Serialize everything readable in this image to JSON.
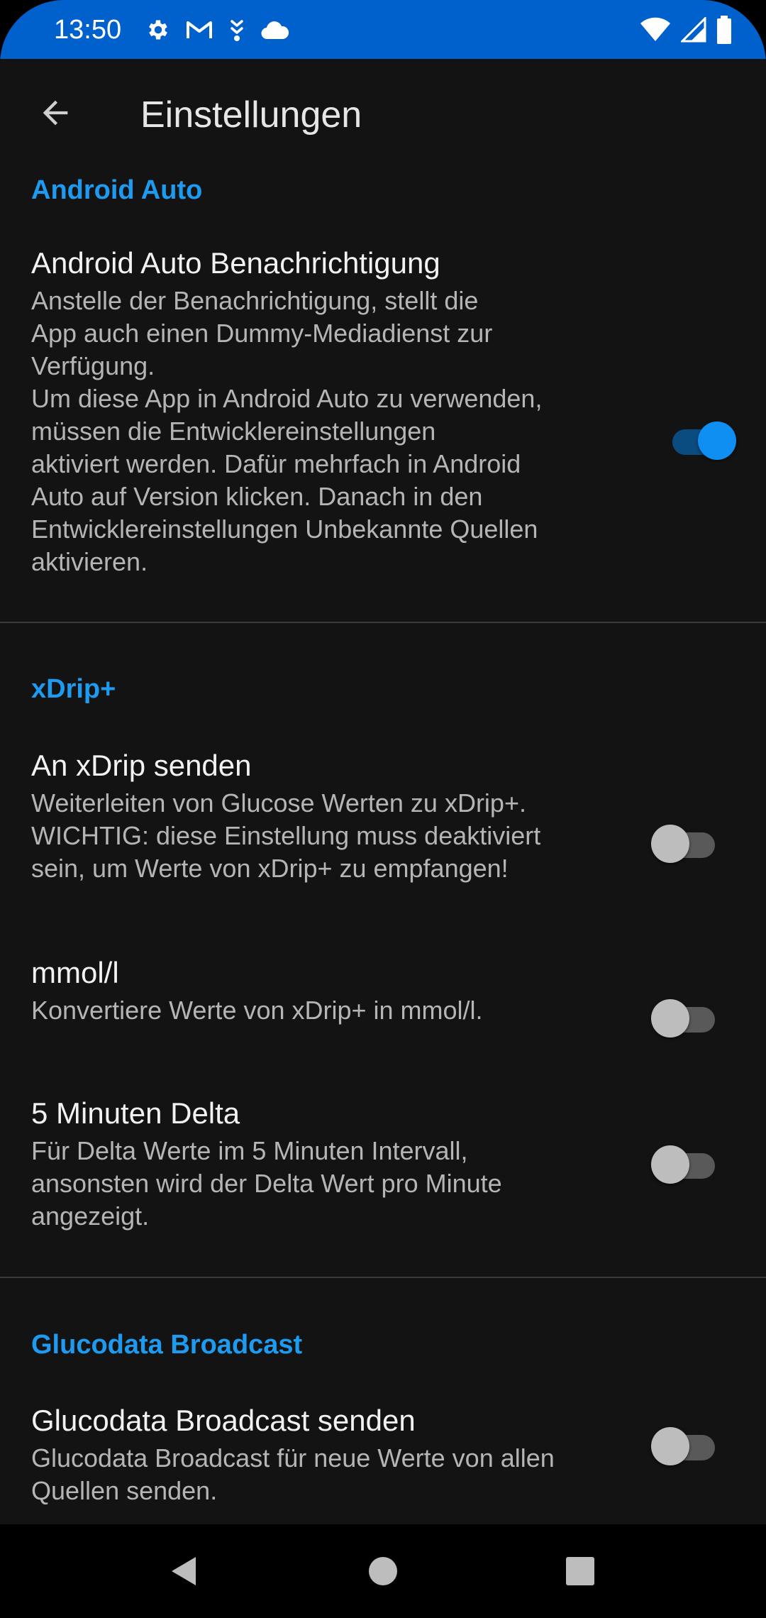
{
  "status_bar": {
    "time": "13:50",
    "left_icons": [
      "gear-icon",
      "gmail-icon",
      "usb-debug-icon",
      "cloud-icon"
    ],
    "right_icons": [
      "wifi-icon",
      "cell-signal-icon",
      "battery-icon"
    ],
    "color": "#0061cc"
  },
  "app_bar": {
    "title": "Einstellungen",
    "back_icon": "arrow-back-icon"
  },
  "sections": {
    "android_auto": {
      "header": "Android Auto",
      "items": [
        {
          "title": "Android Auto Benachrichtigung",
          "summary": "Anstelle der Benachrichtigung, stellt die\nApp auch einen Dummy-Mediadienst zur\nVerfügung.\nUm diese App in Android Auto zu verwenden,\nmüssen die Entwicklereinstellungen\naktiviert werden. Dafür mehrfach in Android\nAuto auf Version klicken. Danach in den\nEntwicklereinstellungen Unbekannte Quellen\naktivieren.",
          "enabled": true
        }
      ]
    },
    "xdrip": {
      "header": "xDrip+",
      "items": [
        {
          "title": "An xDrip senden",
          "summary": "Weiterleiten von Glucose Werten zu xDrip+.\nWICHTIG: diese Einstellung muss deaktiviert\nsein, um Werte von xDrip+ zu empfangen!",
          "enabled": false
        },
        {
          "title": "mmol/l",
          "summary": "Konvertiere Werte von xDrip+ in mmol/l.",
          "enabled": false
        },
        {
          "title": "5 Minuten Delta",
          "summary": "Für Delta Werte im 5 Minuten Intervall,\nansonsten wird der Delta Wert pro Minute\nangezeigt.",
          "enabled": false
        }
      ]
    },
    "glucodata": {
      "header": "Glucodata Broadcast",
      "items": [
        {
          "title": "Glucodata Broadcast senden",
          "summary": "Glucodata Broadcast für neue Werte von allen\nQuellen senden.",
          "enabled": false
        }
      ]
    }
  },
  "nav_bar": {
    "buttons": [
      "nav-back-icon",
      "nav-home-icon",
      "nav-recents-icon"
    ]
  },
  "colors": {
    "accent": "#1e9bf0",
    "background": "#131313",
    "switch_on": "#0f8ff2",
    "switch_off": "#bdbdbd"
  }
}
